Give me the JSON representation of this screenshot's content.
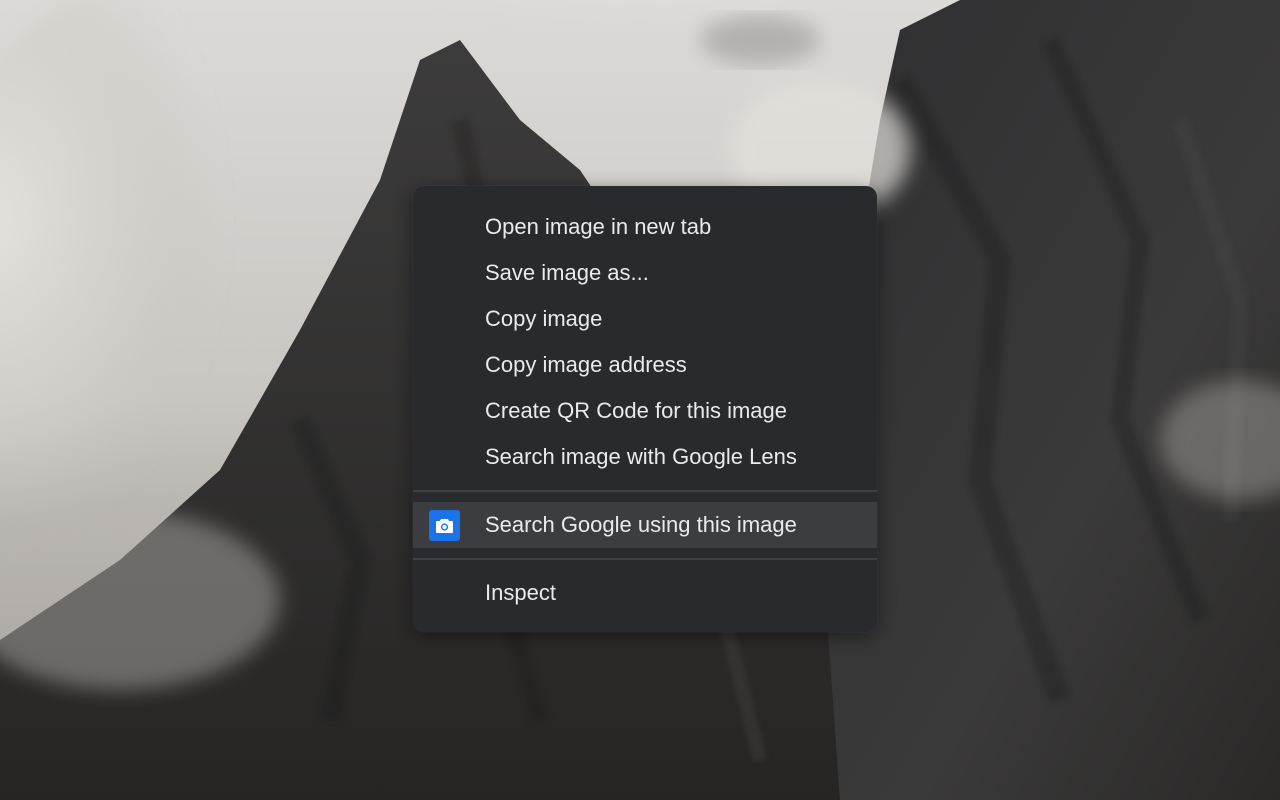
{
  "context_menu": {
    "group_1": [
      {
        "label": "Open image in new tab"
      },
      {
        "label": "Save image as..."
      },
      {
        "label": "Copy image"
      },
      {
        "label": "Copy image address"
      },
      {
        "label": "Create QR Code for this image"
      },
      {
        "label": "Search image with Google Lens"
      }
    ],
    "group_2": [
      {
        "label": "Search Google using this image",
        "icon": "camera-icon",
        "state": "hovered"
      }
    ],
    "group_3": [
      {
        "label": "Inspect"
      }
    ]
  },
  "colors": {
    "menu_background": "#292a2d",
    "menu_text": "#e8eaed",
    "highlight": "#3c3d40",
    "icon_accent": "#1a73e8"
  }
}
